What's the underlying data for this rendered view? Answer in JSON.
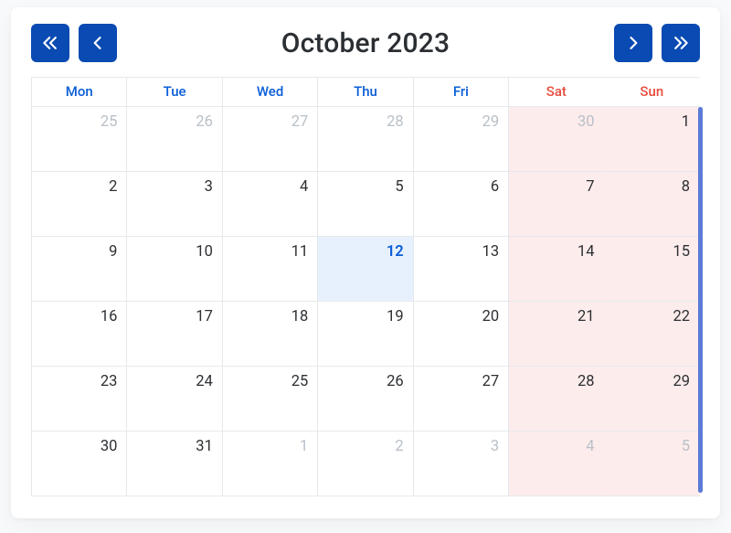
{
  "header": {
    "title": "October 2023"
  },
  "nav": {
    "prev_year": "chevron-double-left",
    "prev_month": "chevron-left",
    "next_month": "chevron-right",
    "next_year": "chevron-double-right"
  },
  "dow": [
    "Mon",
    "Tue",
    "Wed",
    "Thu",
    "Fri",
    "Sat",
    "Sun"
  ],
  "weeks": [
    [
      {
        "n": "25",
        "out": true,
        "weekend": false
      },
      {
        "n": "26",
        "out": true,
        "weekend": false
      },
      {
        "n": "27",
        "out": true,
        "weekend": false
      },
      {
        "n": "28",
        "out": true,
        "weekend": false
      },
      {
        "n": "29",
        "out": true,
        "weekend": false
      },
      {
        "n": "30",
        "out": true,
        "weekend": true
      },
      {
        "n": "1",
        "out": false,
        "weekend": true
      }
    ],
    [
      {
        "n": "2",
        "out": false,
        "weekend": false
      },
      {
        "n": "3",
        "out": false,
        "weekend": false
      },
      {
        "n": "4",
        "out": false,
        "weekend": false
      },
      {
        "n": "5",
        "out": false,
        "weekend": false
      },
      {
        "n": "6",
        "out": false,
        "weekend": false
      },
      {
        "n": "7",
        "out": false,
        "weekend": true
      },
      {
        "n": "8",
        "out": false,
        "weekend": true
      }
    ],
    [
      {
        "n": "9",
        "out": false,
        "weekend": false
      },
      {
        "n": "10",
        "out": false,
        "weekend": false
      },
      {
        "n": "11",
        "out": false,
        "weekend": false
      },
      {
        "n": "12",
        "out": false,
        "weekend": false,
        "today": true
      },
      {
        "n": "13",
        "out": false,
        "weekend": false
      },
      {
        "n": "14",
        "out": false,
        "weekend": true
      },
      {
        "n": "15",
        "out": false,
        "weekend": true
      }
    ],
    [
      {
        "n": "16",
        "out": false,
        "weekend": false
      },
      {
        "n": "17",
        "out": false,
        "weekend": false
      },
      {
        "n": "18",
        "out": false,
        "weekend": false
      },
      {
        "n": "19",
        "out": false,
        "weekend": false
      },
      {
        "n": "20",
        "out": false,
        "weekend": false
      },
      {
        "n": "21",
        "out": false,
        "weekend": true
      },
      {
        "n": "22",
        "out": false,
        "weekend": true
      }
    ],
    [
      {
        "n": "23",
        "out": false,
        "weekend": false
      },
      {
        "n": "24",
        "out": false,
        "weekend": false
      },
      {
        "n": "25",
        "out": false,
        "weekend": false
      },
      {
        "n": "26",
        "out": false,
        "weekend": false
      },
      {
        "n": "27",
        "out": false,
        "weekend": false
      },
      {
        "n": "28",
        "out": false,
        "weekend": true
      },
      {
        "n": "29",
        "out": false,
        "weekend": true
      }
    ],
    [
      {
        "n": "30",
        "out": false,
        "weekend": false
      },
      {
        "n": "31",
        "out": false,
        "weekend": false
      },
      {
        "n": "1",
        "out": true,
        "weekend": false
      },
      {
        "n": "2",
        "out": true,
        "weekend": false
      },
      {
        "n": "3",
        "out": true,
        "weekend": false
      },
      {
        "n": "4",
        "out": true,
        "weekend": true
      },
      {
        "n": "5",
        "out": true,
        "weekend": true
      }
    ]
  ]
}
